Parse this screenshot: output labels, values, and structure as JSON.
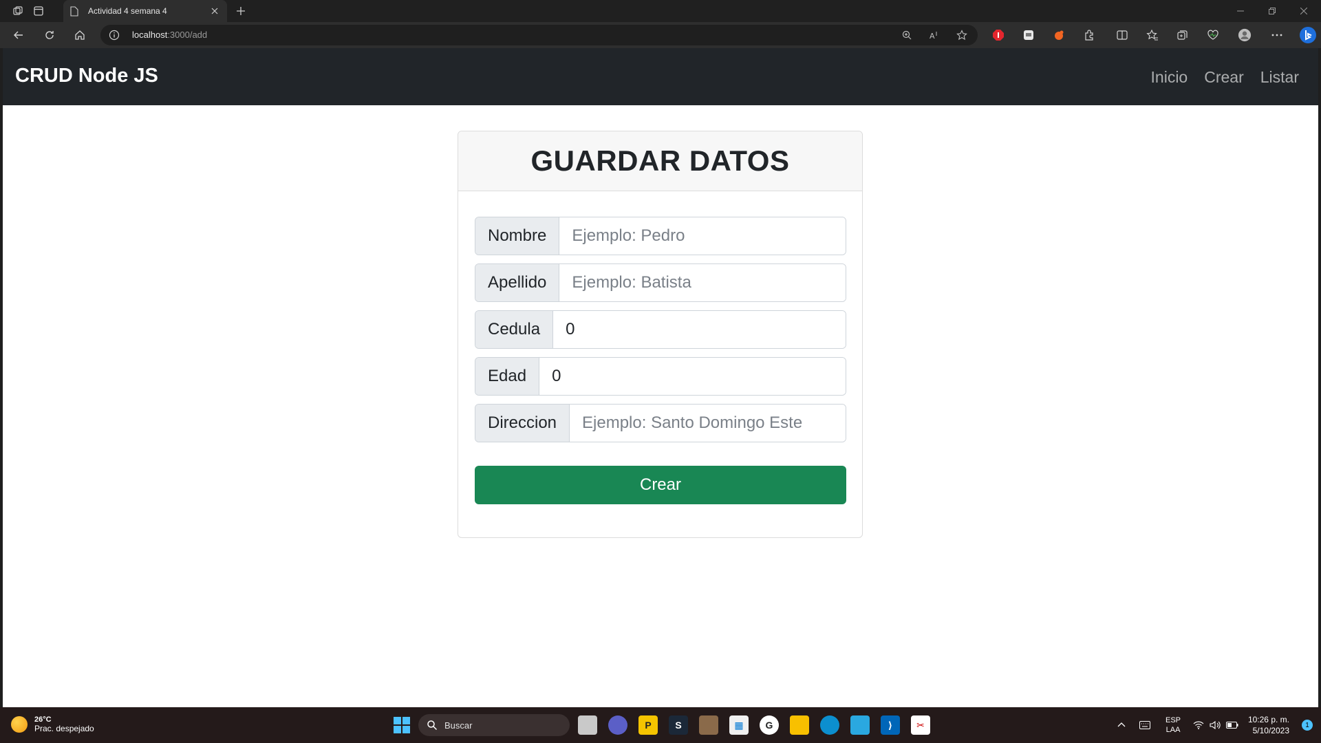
{
  "browser": {
    "tab_title": "Actividad 4 semana 4",
    "url_host": "localhost",
    "url_path": ":3000/add"
  },
  "app": {
    "brand": "CRUD Node JS",
    "nav": [
      "Inicio",
      "Crear",
      "Listar"
    ]
  },
  "form": {
    "title": "GUARDAR DATOS",
    "fields": [
      {
        "label": "Nombre",
        "placeholder": "Ejemplo: Pedro",
        "value": ""
      },
      {
        "label": "Apellido",
        "placeholder": "Ejemplo: Batista",
        "value": ""
      },
      {
        "label": "Cedula",
        "placeholder": "",
        "value": "0"
      },
      {
        "label": "Edad",
        "placeholder": "",
        "value": "0"
      },
      {
        "label": "Direccion",
        "placeholder": "Ejemplo: Santo Domingo Este",
        "value": ""
      }
    ],
    "submit_label": "Crear"
  },
  "taskbar": {
    "weather_temp": "26°C",
    "weather_desc": "Prac. despejado",
    "search_placeholder": "Buscar",
    "lang_top": "ESP",
    "lang_bottom": "LAA",
    "time": "10:26 p. m.",
    "date": "5/10/2023",
    "notification_count": "1"
  },
  "colors": {
    "navbar": "#212529",
    "primary_button": "#198754",
    "taskbar": "#241a1a"
  }
}
